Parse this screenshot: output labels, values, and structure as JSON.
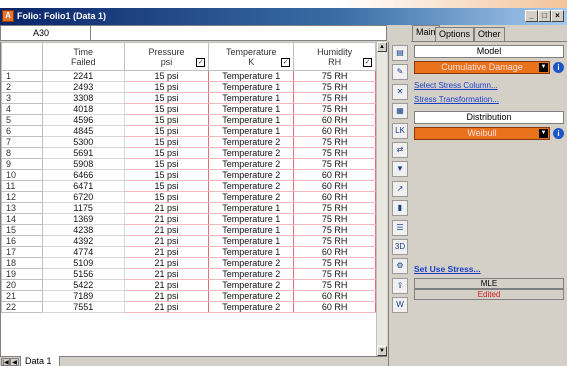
{
  "window": {
    "app_icon": "A",
    "title": "Folio: Folio1 (Data 1)",
    "minimize": "_",
    "restore": "□",
    "close": "×"
  },
  "cell_reference": "A30",
  "columns": [
    {
      "line1": "Time",
      "line2": "Failed",
      "checkbox": false
    },
    {
      "line1": "Pressure",
      "line2": "psi",
      "checkbox": true
    },
    {
      "line1": "Temperature",
      "line2": "K",
      "checkbox": true
    },
    {
      "line1": "Humidity",
      "line2": "RH",
      "checkbox": true
    }
  ],
  "checkbox_mark": "✓",
  "rows": [
    [
      "1",
      "2241",
      "15 psi",
      "Temperature 1",
      "75 RH"
    ],
    [
      "2",
      "2493",
      "15 psi",
      "Temperature 1",
      "75 RH"
    ],
    [
      "3",
      "3308",
      "15 psi",
      "Temperature 1",
      "75 RH"
    ],
    [
      "4",
      "4018",
      "15 psi",
      "Temperature 1",
      "75 RH"
    ],
    [
      "5",
      "4596",
      "15 psi",
      "Temperature 1",
      "60 RH"
    ],
    [
      "6",
      "4845",
      "15 psi",
      "Temperature 1",
      "60 RH"
    ],
    [
      "7",
      "5300",
      "15 psi",
      "Temperature 2",
      "75 RH"
    ],
    [
      "8",
      "5691",
      "15 psi",
      "Temperature 2",
      "75 RH"
    ],
    [
      "9",
      "5908",
      "15 psi",
      "Temperature 2",
      "75 RH"
    ],
    [
      "10",
      "6466",
      "15 psi",
      "Temperature 2",
      "60 RH"
    ],
    [
      "11",
      "6471",
      "15 psi",
      "Temperature 2",
      "60 RH"
    ],
    [
      "12",
      "6720",
      "15 psi",
      "Temperature 2",
      "60 RH"
    ],
    [
      "13",
      "1175",
      "21 psi",
      "Temperature 1",
      "75 RH"
    ],
    [
      "14",
      "1369",
      "21 psi",
      "Temperature 1",
      "75 RH"
    ],
    [
      "15",
      "4238",
      "21 psi",
      "Temperature 1",
      "75 RH"
    ],
    [
      "16",
      "4392",
      "21 psi",
      "Temperature 1",
      "75 RH"
    ],
    [
      "17",
      "4774",
      "21 psi",
      "Temperature 1",
      "60 RH"
    ],
    [
      "18",
      "5109",
      "21 psi",
      "Temperature 2",
      "75 RH"
    ],
    [
      "19",
      "5156",
      "21 psi",
      "Temperature 2",
      "75 RH"
    ],
    [
      "20",
      "5422",
      "21 psi",
      "Temperature 2",
      "75 RH"
    ],
    [
      "21",
      "7189",
      "21 psi",
      "Temperature 2",
      "60 RH"
    ],
    [
      "22",
      "7551",
      "21 psi",
      "Temperature 2",
      "60 RH"
    ]
  ],
  "sheet_tabs": {
    "first": "|◀",
    "prev": "◀",
    "active": "Data 1"
  },
  "scrollbar": {
    "up": "▲",
    "down": "▼"
  },
  "tools": [
    {
      "icon": "report-icon",
      "glyph": "▤"
    },
    {
      "icon": "edit-icon",
      "glyph": "✎"
    },
    {
      "icon": "delete-icon",
      "glyph": "✕"
    },
    {
      "icon": "batch-icon",
      "glyph": "▦"
    },
    {
      "icon": "lk-icon",
      "glyph": "LK"
    },
    {
      "icon": "compare-icon",
      "glyph": "⇄"
    },
    {
      "icon": "filter-icon",
      "glyph": "▼"
    },
    {
      "icon": "plot-icon",
      "glyph": "↗"
    },
    {
      "icon": "bar-chart-icon",
      "glyph": "▮"
    },
    {
      "icon": "table-icon",
      "glyph": "☰"
    },
    {
      "icon": "3d-plot-icon",
      "glyph": "3D"
    },
    {
      "icon": "tools-icon",
      "glyph": "⚙"
    },
    {
      "icon": "share-icon",
      "glyph": "⇪"
    },
    {
      "icon": "word-icon",
      "glyph": "W"
    }
  ],
  "panel": {
    "tabs": [
      "Main",
      "Options",
      "Other"
    ],
    "model_label": "Model",
    "model_value": "Cumulative Damage",
    "select_stress_link": "Select Stress Column...",
    "stress_transform_link": "Stress Transformation...",
    "distribution_label": "Distribution",
    "distribution_value": "Weibull",
    "info_glyph": "i",
    "dropdown_arrow": "▼",
    "use_stress_link": "Set Use Stress...",
    "method": "MLE",
    "status": "Edited",
    "status_color": "#d02020"
  }
}
